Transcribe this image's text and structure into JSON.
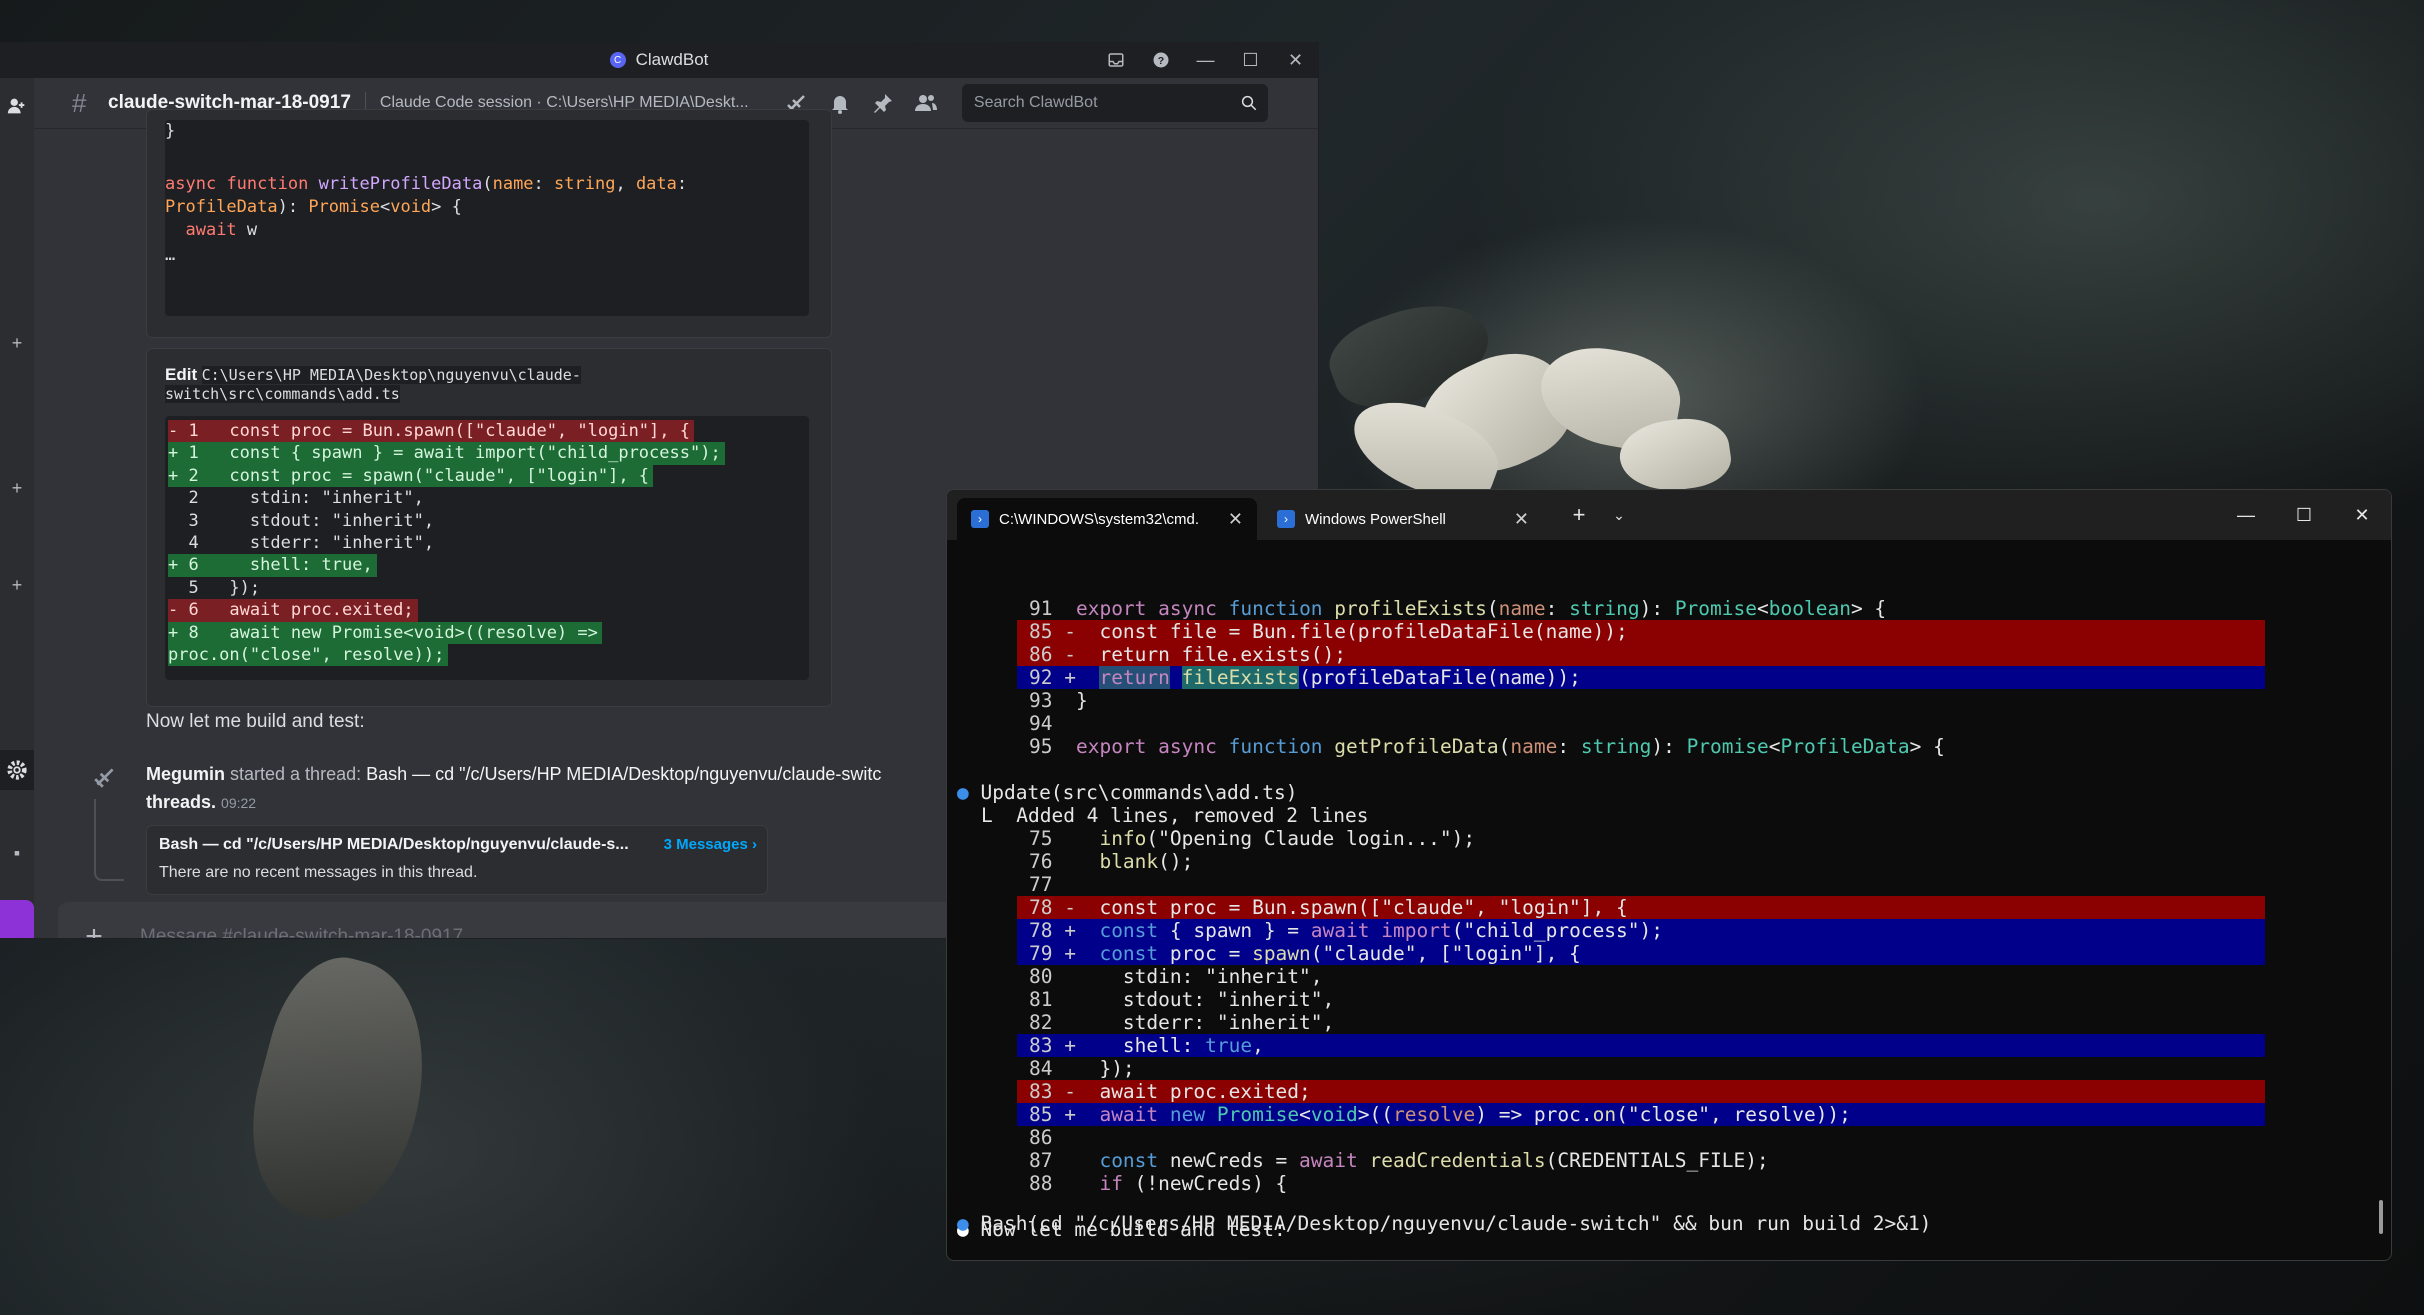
{
  "discord": {
    "window_title": "ClawdBot",
    "channel_name": "claude-switch-mar-18-0917",
    "channel_topic": "Claude Code session · C:\\Users\\HP MEDIA\\Deskt...",
    "search_placeholder": "Search ClawdBot",
    "first_code": {
      "close_brace": "}",
      "lines": [
        [
          "async function writeProfileData(",
          "name",
          ": ",
          "string",
          ", ",
          "data",
          ":"
        ],
        [
          "ProfileData",
          "): ",
          "Promise",
          "<",
          "void",
          "> {"
        ],
        [
          "  await w"
        ],
        [
          "…"
        ]
      ]
    },
    "edit_embed": {
      "label": "Edit",
      "path_line1": "C:\\Users\\HP MEDIA\\Desktop\\nguyenvu\\claude-",
      "path_line2": "switch\\src\\commands\\add.ts",
      "diff": [
        {
          "kind": "del",
          "text": "- 1   const proc = Bun.spawn([\"claude\", \"login\"], {"
        },
        {
          "kind": "add",
          "text": "+ 1   const { spawn } = await import(\"child_process\");"
        },
        {
          "kind": "add",
          "text": "+ 2   const proc = spawn(\"claude\", [\"login\"], {"
        },
        {
          "kind": "ctx",
          "text": "  2     stdin: \"inherit\","
        },
        {
          "kind": "ctx",
          "text": "  3     stdout: \"inherit\","
        },
        {
          "kind": "ctx",
          "text": "  4     stderr: \"inherit\","
        },
        {
          "kind": "add",
          "text": "+ 6     shell: true,"
        },
        {
          "kind": "ctx",
          "text": "  5   });"
        },
        {
          "kind": "del",
          "text": "- 6   await proc.exited;"
        },
        {
          "kind": "add",
          "text": "+ 8   await new Promise<void>((resolve) =>"
        },
        {
          "kind": "add",
          "text": "proc.on(\"close\", resolve));"
        }
      ]
    },
    "message_build": "Now let me build and test:",
    "thread": {
      "author": "Megumin",
      "action": "started a thread:",
      "thread_name": "Bash — cd \"/c/Users/HP MEDIA/Desktop/nguyenvu/claude-switc",
      "see_all": "threads.",
      "time": "09:22",
      "card_title": "Bash — cd \"/c/Users/HP MEDIA/Desktop/nguyenvu/claude-s...",
      "card_link": "3 Messages ›",
      "card_empty": "There are no recent messages in this thread."
    },
    "composer_placeholder": "Message #claude-switch-mar-18-0917"
  },
  "terminal": {
    "tabs": [
      {
        "title": "C:\\WINDOWS\\system32\\cmd.",
        "active": true
      },
      {
        "title": "Windows PowerShell",
        "active": false
      }
    ],
    "bullets": {
      "update": "Update(src\\commands\\add.ts)",
      "update_detail": "Added 4 lines, removed 2 lines",
      "build": "Now let me build and test:",
      "bash": "Bash(cd \"/c/Users/HP MEDIA/Desktop/nguyenvu/claude-switch\" && bun run build 2>&1)"
    }
  }
}
